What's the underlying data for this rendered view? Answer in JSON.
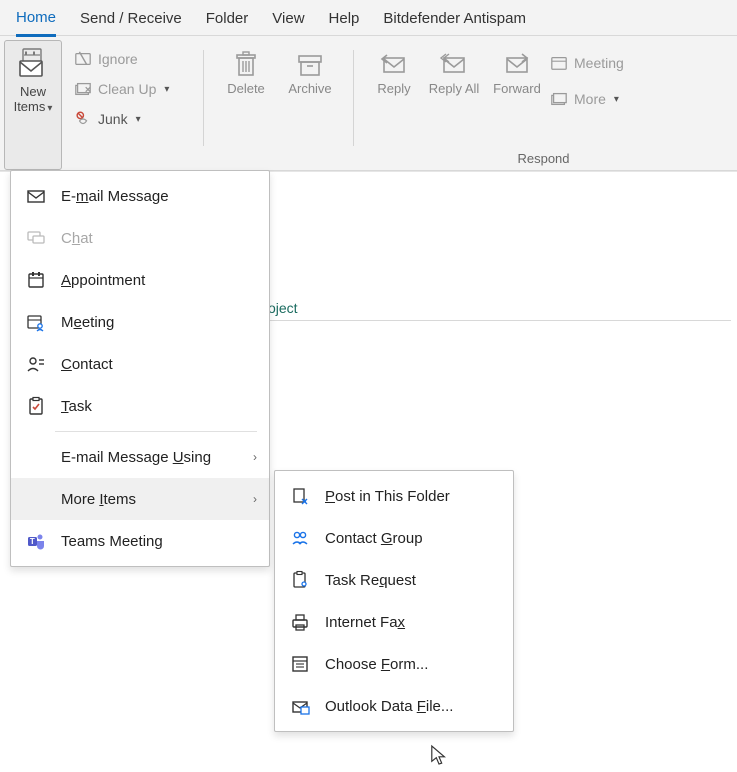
{
  "tabs": {
    "home": "Home",
    "send_receive": "Send / Receive",
    "folder": "Folder",
    "view": "View",
    "help": "Help",
    "bitdefender": "Bitdefender Antispam"
  },
  "ribbon": {
    "new_items": {
      "line1": "New",
      "line2": "Items"
    },
    "ignore": "Ignore",
    "clean_up": "Clean Up",
    "junk": "Junk",
    "delete": "Delete",
    "archive": "Archive",
    "reply": "Reply",
    "reply_all": "Reply All",
    "forward": "Forward",
    "meeting": "Meeting",
    "more": "More",
    "respond_label": "Respond"
  },
  "content": {
    "partial_text": "oject"
  },
  "menu": {
    "email_message": "E-mail Message",
    "chat": "Chat",
    "appointment": "Appointment",
    "meeting": "Meeting",
    "contact": "Contact",
    "task": "Task",
    "email_message_using": "E-mail Message Using",
    "more_items": "More Items",
    "teams_meeting": "Teams Meeting"
  },
  "submenu": {
    "post_in_folder": "Post in This Folder",
    "contact_group": "Contact Group",
    "task_request": "Task Request",
    "internet_fax": "Internet Fax",
    "choose_form": "Choose Form...",
    "outlook_data_file": "Outlook Data File..."
  },
  "hotkeys": {
    "email_message_u": "m",
    "chat_u": "h",
    "appointment_u": "A",
    "meeting_u": "e",
    "contact_u": "C",
    "task_u": "T",
    "email_using_u": "U",
    "more_items_u": "I",
    "post_u": "P",
    "contact_group_u": "G",
    "task_request_u": "q",
    "internet_fax_u": "x",
    "choose_form_u": "F",
    "data_file_u": "F"
  }
}
